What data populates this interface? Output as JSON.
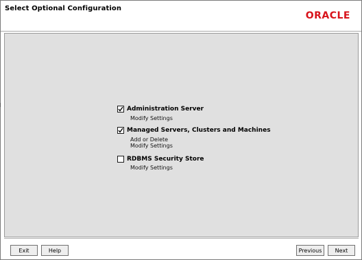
{
  "header": {
    "title": "Select Optional Configuration",
    "logo": "ORACLE"
  },
  "options": [
    {
      "label": "Administration Server",
      "checked": true,
      "subs": [
        "Modify Settings"
      ]
    },
    {
      "label": "Managed Servers, Clusters and Machines",
      "checked": true,
      "subs": [
        "Add or Delete",
        "Modify Settings"
      ]
    },
    {
      "label": "RDBMS Security Store",
      "checked": false,
      "subs": [
        "Modify Settings"
      ]
    }
  ],
  "buttons": {
    "exit": "Exit",
    "help": "Help",
    "previous": "Previous",
    "next": "Next"
  },
  "colors": {
    "brand": "#d8131b",
    "panel": "#e0e0e0"
  }
}
